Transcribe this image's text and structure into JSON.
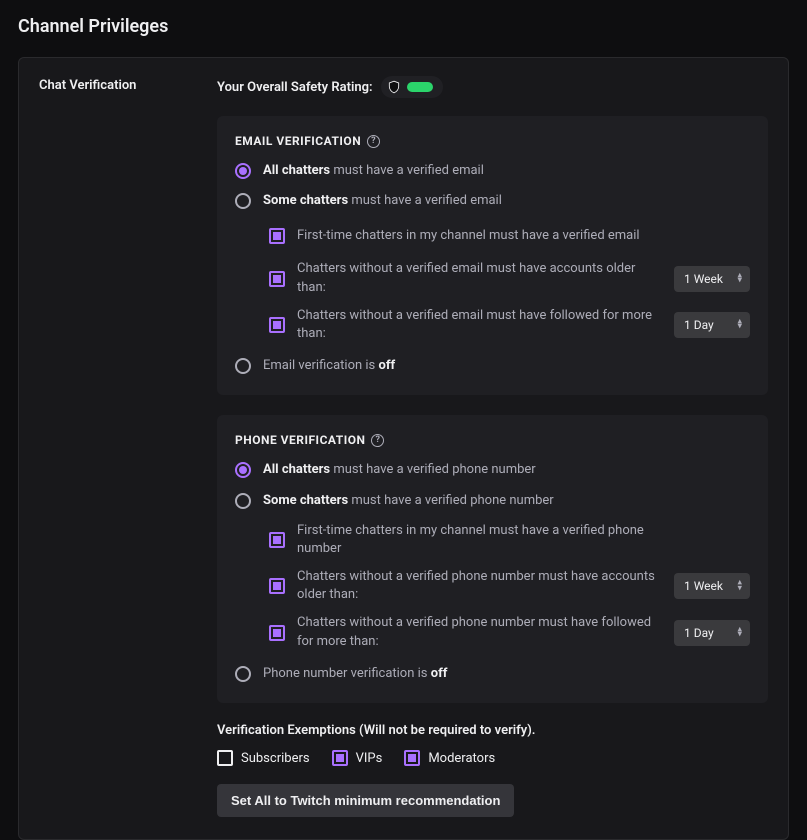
{
  "pageTitle": "Channel Privileges",
  "panelLabel": "Chat Verification",
  "ratingLabel": "Your Overall Safety Rating:",
  "email": {
    "header": "EMAIL VERIFICATION",
    "optAllBold": "All chatters",
    "optAllRest": " must have a verified email",
    "optSomeBold": "Some chatters",
    "optSomeRest": " must have a verified email",
    "sub1": "First-time chatters in my channel must have a verified email",
    "sub2": "Chatters without a verified email must have accounts older than:",
    "sub2Select": "1 Week",
    "sub3": "Chatters without a verified email must have followed for more than:",
    "sub3Select": "1 Day",
    "optOffPrefix": "Email verification is ",
    "optOffBold": "off"
  },
  "phone": {
    "header": "PHONE VERIFICATION",
    "optAllBold": "All chatters",
    "optAllRest": " must have a verified phone number",
    "optSomeBold": "Some chatters",
    "optSomeRest": " must have a verified phone number",
    "sub1": "First-time chatters in my channel must have a verified phone number",
    "sub2": "Chatters without a verified phone number must have accounts older than:",
    "sub2Select": "1 Week",
    "sub3": "Chatters without a verified phone number must have followed for more than:",
    "sub3Select": "1 Day",
    "optOffPrefix": "Phone number verification is ",
    "optOffBold": "off"
  },
  "exemptions": {
    "title": "Verification Exemptions (Will not be required to verify).",
    "subscribers": "Subscribers",
    "vips": "VIPs",
    "moderators": "Moderators"
  },
  "buttonLabel": "Set All to Twitch minimum recommendation"
}
